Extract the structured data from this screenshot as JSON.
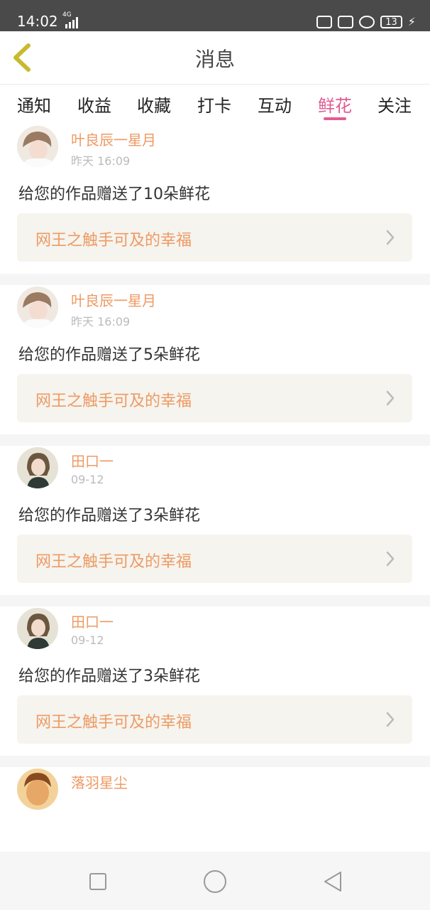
{
  "status_bar": {
    "time": "14:02",
    "network": "4G",
    "battery": "13"
  },
  "header": {
    "title": "消息",
    "back_icon": "chevron-left-icon"
  },
  "tabs": [
    {
      "label": "通知"
    },
    {
      "label": "收益"
    },
    {
      "label": "收藏"
    },
    {
      "label": "打卡"
    },
    {
      "label": "互动"
    },
    {
      "label": "鲜花",
      "active": true
    },
    {
      "label": "关注"
    }
  ],
  "colors": {
    "accent_pink": "#e15d94",
    "orange_text": "#ee9a64",
    "work_bg": "#f5f4ee"
  },
  "messages": [
    {
      "user": "叶良辰一星月",
      "time": "昨天 16:09",
      "text": "给您的作品赠送了10朵鲜花",
      "work": "网王之触手可及的幸福"
    },
    {
      "user": "叶良辰一星月",
      "time": "昨天 16:09",
      "text": "给您的作品赠送了5朵鲜花",
      "work": "网王之触手可及的幸福"
    },
    {
      "user": "田口一",
      "time": "09-12",
      "text": "给您的作品赠送了3朵鲜花",
      "work": "网王之触手可及的幸福"
    },
    {
      "user": "田口一",
      "time": "09-12",
      "text": "给您的作品赠送了3朵鲜花",
      "work": "网王之触手可及的幸福"
    },
    {
      "user": "落羽星尘"
    }
  ]
}
